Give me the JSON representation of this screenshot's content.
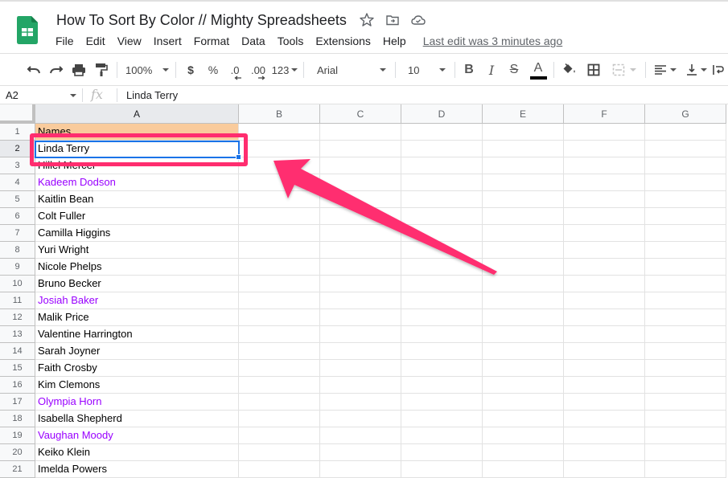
{
  "app": {
    "doc_title": "How To Sort By Color // Mighty Spreadsheets",
    "title_icons": [
      "star-icon",
      "move-to-folder-icon",
      "cloud-saved-icon"
    ],
    "menu": [
      "File",
      "Edit",
      "View",
      "Insert",
      "Format",
      "Data",
      "Tools",
      "Extensions",
      "Help"
    ],
    "last_edit": "Last edit was 3 minutes ago"
  },
  "toolbar": {
    "zoom": "100%",
    "currency": "$",
    "percent": "%",
    "decrease_decimal": ".0",
    "increase_decimal": ".00",
    "more_formats": "123",
    "font": "Arial",
    "font_size": "10",
    "bold": "B",
    "italic": "I",
    "strikethrough": "S",
    "text_color_label": "A",
    "text_color": "#000000"
  },
  "formula_bar": {
    "cell_ref": "A2",
    "fx": "fx",
    "content": "Linda Terry"
  },
  "sheet": {
    "columns": [
      "A",
      "B",
      "C",
      "D",
      "E",
      "F",
      "G"
    ],
    "selected_cell": "A2",
    "header_fill_color": "#f9cb9c",
    "highlight_color": "#9900ff",
    "annotation_color": "#ff2d6f",
    "rows": [
      {
        "n": "1",
        "a": "Names",
        "style": "header"
      },
      {
        "n": "2",
        "a": "Linda Terry",
        "style": "normal"
      },
      {
        "n": "3",
        "a": "Hillel Mercer",
        "style": "normal"
      },
      {
        "n": "4",
        "a": "Kadeem Dodson",
        "style": "purple"
      },
      {
        "n": "5",
        "a": "Kaitlin Bean",
        "style": "normal"
      },
      {
        "n": "6",
        "a": "Colt Fuller",
        "style": "normal"
      },
      {
        "n": "7",
        "a": "Camilla Higgins",
        "style": "normal"
      },
      {
        "n": "8",
        "a": "Yuri Wright",
        "style": "normal"
      },
      {
        "n": "9",
        "a": "Nicole Phelps",
        "style": "normal"
      },
      {
        "n": "10",
        "a": "Bruno Becker",
        "style": "normal"
      },
      {
        "n": "11",
        "a": "Josiah Baker",
        "style": "purple"
      },
      {
        "n": "12",
        "a": "Malik Price",
        "style": "normal"
      },
      {
        "n": "13",
        "a": "Valentine Harrington",
        "style": "normal"
      },
      {
        "n": "14",
        "a": "Sarah Joyner",
        "style": "normal"
      },
      {
        "n": "15",
        "a": "Faith Crosby",
        "style": "normal"
      },
      {
        "n": "16",
        "a": "Kim Clemons",
        "style": "normal"
      },
      {
        "n": "17",
        "a": "Olympia Horn",
        "style": "purple"
      },
      {
        "n": "18",
        "a": "Isabella Shepherd",
        "style": "normal"
      },
      {
        "n": "19",
        "a": "Vaughan Moody",
        "style": "purple"
      },
      {
        "n": "20",
        "a": "Keiko Klein",
        "style": "normal"
      },
      {
        "n": "21",
        "a": "Imelda Powers",
        "style": "normal"
      }
    ]
  }
}
